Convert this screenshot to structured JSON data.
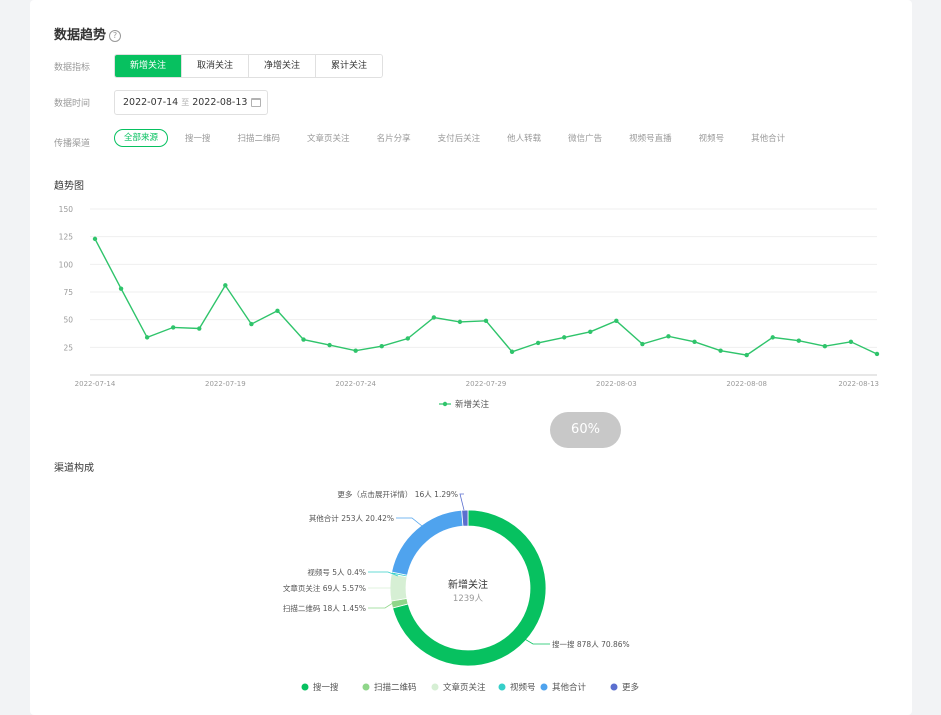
{
  "title": "数据趋势",
  "help_icon": "?",
  "metric": {
    "label": "数据指标",
    "tabs": [
      {
        "label": "新增关注",
        "active": true
      },
      {
        "label": "取消关注",
        "active": false
      },
      {
        "label": "净增关注",
        "active": false
      },
      {
        "label": "累计关注",
        "active": false
      }
    ]
  },
  "time": {
    "label": "数据时间",
    "start": "2022-07-14",
    "separator": "至",
    "end": "2022-08-13"
  },
  "channel": {
    "label": "传播渠道",
    "chips": [
      {
        "label": "全部来源",
        "active": true
      },
      {
        "label": "搜一搜"
      },
      {
        "label": "扫描二维码"
      },
      {
        "label": "文章页关注"
      },
      {
        "label": "名片分享"
      },
      {
        "label": "支付后关注"
      },
      {
        "label": "他人转载"
      },
      {
        "label": "微信广告"
      },
      {
        "label": "视频号直播"
      },
      {
        "label": "视频号"
      },
      {
        "label": "其他合计"
      }
    ]
  },
  "trend_title": "趋势图",
  "loading_pill": "60%",
  "breakdown_title": "渠道构成",
  "colors": {
    "accent": "#07c160",
    "line": "#2fc46b",
    "donut": [
      "#07c160",
      "#8fd68a",
      "#d6efd4",
      "#36cfc9",
      "#4fa3ee",
      "#5b6fcf"
    ]
  },
  "chart_data": [
    {
      "type": "line",
      "title": "",
      "x_tick_labels": [
        "2022-07-14",
        "2022-07-19",
        "2022-07-24",
        "2022-07-29",
        "2022-08-03",
        "2022-08-08",
        "2022-08-13"
      ],
      "x": [
        "2022-07-14",
        "2022-07-15",
        "2022-07-16",
        "2022-07-17",
        "2022-07-18",
        "2022-07-19",
        "2022-07-20",
        "2022-07-21",
        "2022-07-22",
        "2022-07-23",
        "2022-07-24",
        "2022-07-25",
        "2022-07-26",
        "2022-07-27",
        "2022-07-28",
        "2022-07-29",
        "2022-07-30",
        "2022-07-31",
        "2022-08-01",
        "2022-08-02",
        "2022-08-03",
        "2022-08-04",
        "2022-08-05",
        "2022-08-06",
        "2022-08-07",
        "2022-08-08",
        "2022-08-09",
        "2022-08-10",
        "2022-08-11",
        "2022-08-12",
        "2022-08-13"
      ],
      "series": [
        {
          "name": "新增关注",
          "values": [
            123,
            78,
            34,
            43,
            42,
            81,
            46,
            58,
            32,
            27,
            22,
            26,
            33,
            52,
            48,
            49,
            21,
            29,
            34,
            39,
            49,
            28,
            35,
            30,
            22,
            18,
            34,
            31,
            26,
            30,
            19
          ]
        }
      ],
      "y_ticks": [
        25,
        50,
        75,
        100,
        125,
        150
      ],
      "ylim": [
        0,
        150
      ],
      "grid": true,
      "legend": "bottom-center"
    },
    {
      "type": "pie",
      "center_label": "新增关注",
      "center_value": "1239人",
      "slices": [
        {
          "name": "搜一搜",
          "label": "搜一搜 878人 70.86%",
          "value": 878
        },
        {
          "name": "扫描二维码",
          "label": "扫描二维码 18人 1.45%",
          "value": 18
        },
        {
          "name": "文章页关注",
          "label": "文章页关注 69人 5.57%",
          "value": 69
        },
        {
          "name": "视频号",
          "label": "视频号 5人 0.4%",
          "value": 5
        },
        {
          "name": "其他合计",
          "label": "其他合计 253人 20.42%",
          "value": 253
        },
        {
          "name": "更多",
          "label": "更多（点击展开详情） 16人 1.29%",
          "value": 16
        }
      ],
      "legend_labels": [
        "搜一搜",
        "扫描二维码",
        "文章页关注",
        "视频号",
        "其他合计",
        "更多"
      ],
      "legend": "bottom-center"
    }
  ]
}
